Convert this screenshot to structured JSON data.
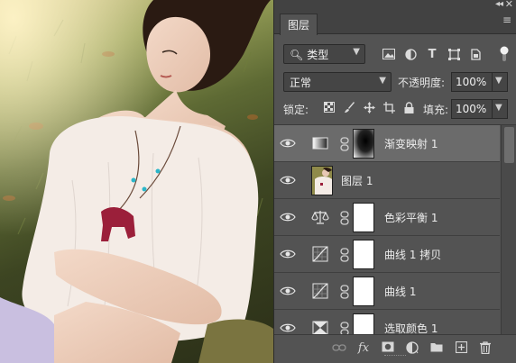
{
  "panel": {
    "tab_label": "图层",
    "filter": {
      "kind_label": "类型",
      "icons": [
        "image-filter-icon",
        "adjustment-filter-icon",
        "type-filter-icon",
        "shape-filter-icon",
        "smart-object-filter-icon",
        "filter-toggle-icon"
      ]
    },
    "blend_mode": "正常",
    "opacity_label": "不透明度:",
    "opacity_value": "100%",
    "lock_label": "锁定:",
    "fill_label": "填充:",
    "fill_value": "100%",
    "layers": [
      {
        "name": "渐变映射 1",
        "type": "gradient-map",
        "selected": true,
        "visible": true,
        "has_mask": true
      },
      {
        "name": "图层 1",
        "type": "pixel",
        "selected": false,
        "visible": true,
        "has_mask": false
      },
      {
        "name": "色彩平衡 1",
        "type": "color-balance",
        "selected": false,
        "visible": true,
        "has_mask": true
      },
      {
        "name": "曲线 1 拷贝",
        "type": "curves",
        "selected": false,
        "visible": true,
        "has_mask": true
      },
      {
        "name": "曲线 1",
        "type": "curves",
        "selected": false,
        "visible": true,
        "has_mask": true
      },
      {
        "name": "选取颜色 1",
        "type": "selective-color",
        "selected": false,
        "visible": true,
        "has_mask": true
      }
    ],
    "bottom_icons": [
      "link-layers-icon",
      "fx-icon",
      "add-mask-icon",
      "new-adjustment-icon",
      "new-group-icon",
      "new-layer-icon",
      "delete-icon"
    ],
    "fx_label": "fx"
  },
  "colors": {
    "panel_bg": "#535353",
    "selected_row": "#6b6b6b",
    "header_bg": "#424242"
  }
}
